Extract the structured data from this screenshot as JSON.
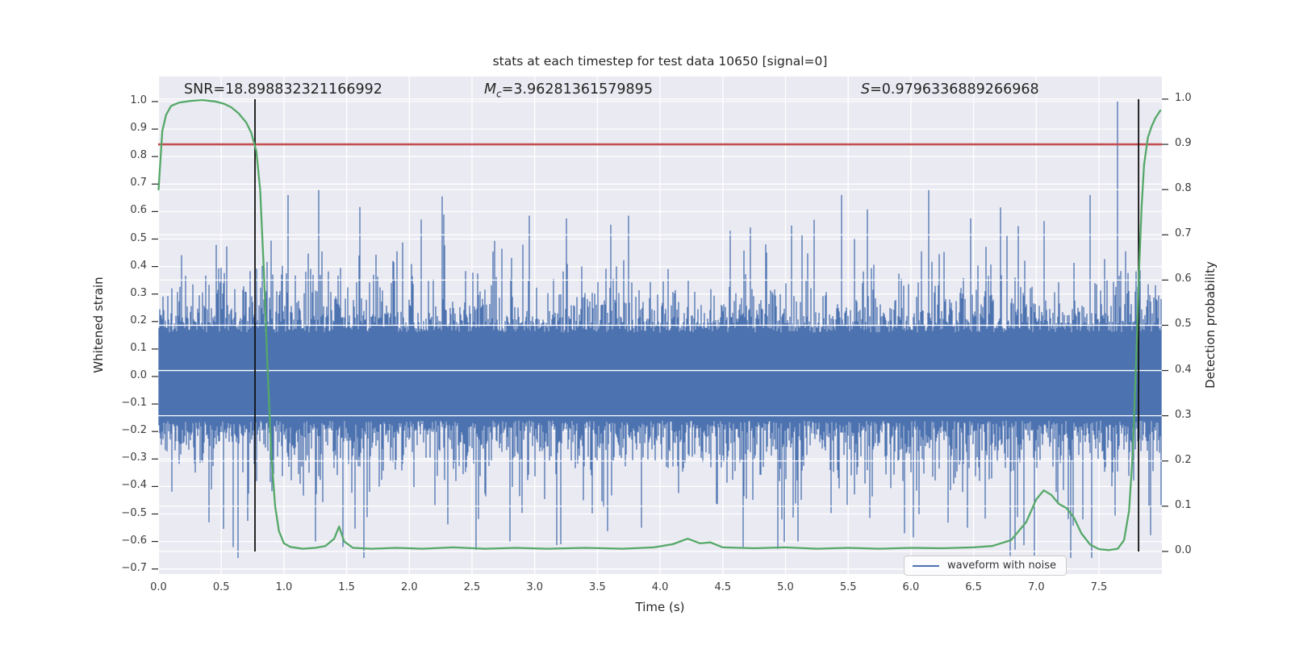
{
  "figure": {
    "title": "stats at each timestep for test data 10650 [signal=0]",
    "annotations": {
      "snr": {
        "text": "SNR=18.898832321166992"
      },
      "chirp_mass": {
        "symbol": "M",
        "subscript": "c",
        "rest": "=3.96281361579895"
      },
      "significance": {
        "symbol": "S",
        "rest": "=0.9796336889266968"
      }
    }
  },
  "axes": {
    "x": {
      "label": "Time (s)",
      "tick_labels": [
        "0.0",
        "0.5",
        "1.0",
        "1.5",
        "2.0",
        "2.5",
        "3.0",
        "3.5",
        "4.0",
        "4.5",
        "5.0",
        "5.5",
        "6.0",
        "6.5",
        "7.0",
        "7.5"
      ],
      "tick_values": [
        0,
        0.5,
        1,
        1.5,
        2,
        2.5,
        3,
        3.5,
        4,
        4.5,
        5,
        5.5,
        6,
        6.5,
        7,
        7.5
      ],
      "range": [
        0,
        8.0
      ]
    },
    "y_left": {
      "label": "Whitened strain",
      "tick_labels": [
        "1.0",
        "0.9",
        "0.8",
        "0.7",
        "0.6",
        "0.5",
        "0.4",
        "0.3",
        "0.2",
        "0.1",
        "0.0",
        "−0.1",
        "−0.2",
        "−0.3",
        "−0.4",
        "−0.5",
        "−0.6",
        "−0.7"
      ],
      "tick_values": [
        1.0,
        0.9,
        0.8,
        0.7,
        0.6,
        0.5,
        0.4,
        0.3,
        0.2,
        0.1,
        0.0,
        -0.1,
        -0.2,
        -0.3,
        -0.4,
        -0.5,
        -0.6,
        -0.7
      ],
      "range": [
        -0.73,
        1.08
      ]
    },
    "y_right": {
      "label": "Detection probability",
      "tick_labels": [
        "1.0",
        "0.9",
        "0.8",
        "0.7",
        "0.6",
        "0.5",
        "0.4",
        "0.3",
        "0.2",
        "0.1",
        "0.0"
      ],
      "tick_values": [
        1.0,
        0.9,
        0.8,
        0.7,
        0.6,
        0.5,
        0.4,
        0.3,
        0.2,
        0.1,
        0.0
      ],
      "range": [
        -0.05,
        1.05
      ]
    }
  },
  "legend": {
    "items": [
      {
        "label": "waveform with noise",
        "color": "#4c72b0"
      }
    ]
  },
  "colors": {
    "axes_background": "#eaeaf2",
    "grid": "#ffffff",
    "waveform": "#4c72b0",
    "detection_curve": "#55a868",
    "threshold_line": "#c44e52",
    "event_marker": "#111111",
    "text": "#262626"
  },
  "chart_data": {
    "type": "line",
    "title": "stats at each timestep for test data 10650 [signal=0]",
    "xlabel": "Time (s)",
    "ylabel_left": "Whitened strain",
    "ylabel_right": "Detection probability",
    "xlim": [
      0,
      8.0
    ],
    "ylim_left": [
      -0.73,
      1.08
    ],
    "ylim_right": [
      -0.05,
      1.05
    ],
    "grid": true,
    "stats": {
      "SNR": 18.898832321166992,
      "Mc": 3.96281361579895,
      "S": 0.9796336889266968
    },
    "threshold": {
      "axis": "right",
      "value": 0.9
    },
    "event_marker_times": [
      0.769,
      7.816
    ],
    "series": [
      {
        "name": "waveform with noise",
        "axis": "left",
        "representation": "stochastic min-max noise envelope",
        "seed": 1337,
        "dense_band": 0.16,
        "spike_scale": 0.082,
        "spike_cap": 0.66,
        "extreme_spikes": [
          [
            1.28,
            0.68
          ],
          [
            2.26,
            0.655
          ],
          [
            2.96,
            0.585
          ],
          [
            3.25,
            0.575
          ],
          [
            3.75,
            0.585
          ],
          [
            4.56,
            0.53
          ],
          [
            5.23,
            0.57
          ],
          [
            6.14,
            0.68
          ],
          [
            6.48,
            0.575
          ],
          [
            7.06,
            0.565
          ],
          [
            7.645,
            1.0
          ],
          [
            0.4,
            -0.53
          ],
          [
            1.25,
            -0.6
          ],
          [
            1.47,
            -0.62
          ],
          [
            2.53,
            -0.63
          ],
          [
            2.8,
            -0.6
          ],
          [
            3.21,
            -0.61
          ],
          [
            3.85,
            -0.55
          ],
          [
            4.66,
            -0.62
          ],
          [
            4.97,
            -0.52
          ],
          [
            5.1,
            -0.6
          ],
          [
            5.95,
            -0.57
          ],
          [
            6.45,
            -0.55
          ],
          [
            6.83,
            -0.63
          ],
          [
            7.37,
            -0.52
          ]
        ]
      },
      {
        "name": "detection probability",
        "axis": "right",
        "points": [
          [
            0.0,
            0.8
          ],
          [
            0.03,
            0.93
          ],
          [
            0.06,
            0.965
          ],
          [
            0.1,
            0.985
          ],
          [
            0.16,
            0.992
          ],
          [
            0.25,
            0.996
          ],
          [
            0.35,
            0.998
          ],
          [
            0.45,
            0.995
          ],
          [
            0.52,
            0.99
          ],
          [
            0.58,
            0.982
          ],
          [
            0.64,
            0.968
          ],
          [
            0.7,
            0.948
          ],
          [
            0.74,
            0.925
          ],
          [
            0.78,
            0.885
          ],
          [
            0.81,
            0.8
          ],
          [
            0.84,
            0.62
          ],
          [
            0.87,
            0.4
          ],
          [
            0.9,
            0.21
          ],
          [
            0.93,
            0.1
          ],
          [
            0.96,
            0.045
          ],
          [
            1.0,
            0.018
          ],
          [
            1.05,
            0.01
          ],
          [
            1.15,
            0.006
          ],
          [
            1.25,
            0.008
          ],
          [
            1.33,
            0.012
          ],
          [
            1.4,
            0.028
          ],
          [
            1.44,
            0.055
          ],
          [
            1.48,
            0.022
          ],
          [
            1.55,
            0.008
          ],
          [
            1.7,
            0.006
          ],
          [
            1.9,
            0.008
          ],
          [
            2.1,
            0.006
          ],
          [
            2.35,
            0.009
          ],
          [
            2.6,
            0.006
          ],
          [
            2.85,
            0.008
          ],
          [
            3.1,
            0.006
          ],
          [
            3.4,
            0.008
          ],
          [
            3.7,
            0.006
          ],
          [
            3.95,
            0.009
          ],
          [
            4.1,
            0.016
          ],
          [
            4.22,
            0.028
          ],
          [
            4.32,
            0.018
          ],
          [
            4.4,
            0.02
          ],
          [
            4.5,
            0.009
          ],
          [
            4.75,
            0.007
          ],
          [
            5.0,
            0.009
          ],
          [
            5.25,
            0.006
          ],
          [
            5.5,
            0.008
          ],
          [
            5.75,
            0.006
          ],
          [
            6.0,
            0.008
          ],
          [
            6.25,
            0.007
          ],
          [
            6.5,
            0.009
          ],
          [
            6.65,
            0.012
          ],
          [
            6.8,
            0.025
          ],
          [
            6.92,
            0.065
          ],
          [
            7.0,
            0.115
          ],
          [
            7.06,
            0.135
          ],
          [
            7.12,
            0.125
          ],
          [
            7.18,
            0.105
          ],
          [
            7.24,
            0.096
          ],
          [
            7.3,
            0.075
          ],
          [
            7.36,
            0.04
          ],
          [
            7.43,
            0.015
          ],
          [
            7.5,
            0.005
          ],
          [
            7.58,
            0.003
          ],
          [
            7.65,
            0.006
          ],
          [
            7.7,
            0.025
          ],
          [
            7.74,
            0.09
          ],
          [
            7.77,
            0.22
          ],
          [
            7.8,
            0.45
          ],
          [
            7.82,
            0.62
          ],
          [
            7.84,
            0.76
          ],
          [
            7.86,
            0.855
          ],
          [
            7.89,
            0.915
          ],
          [
            7.92,
            0.94
          ],
          [
            7.95,
            0.958
          ],
          [
            7.99,
            0.975
          ]
        ]
      }
    ],
    "legend_entries": [
      "waveform with noise"
    ],
    "legend_position": "lower right"
  }
}
